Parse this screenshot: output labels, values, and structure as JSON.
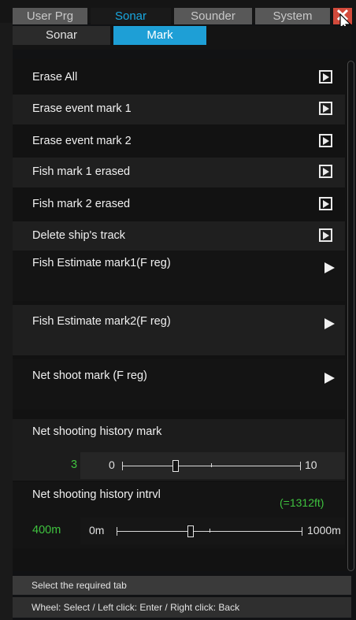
{
  "top_tabs": [
    "User Prg",
    "Sonar",
    "Sounder",
    "System"
  ],
  "sub_tabs": [
    "Sonar",
    "Mark"
  ],
  "actions": [
    "Erase All",
    "Erase event mark 1",
    "Erase event mark 2",
    "Fish mark 1 erased",
    "Fish mark 2 erased",
    "Delete ship's track"
  ],
  "submenus": [
    "Fish Estimate mark1(F reg)",
    "Fish Estimate mark2(F reg)",
    "Net shoot mark (F reg)"
  ],
  "net_history_mark": {
    "title": "Net shooting history mark",
    "value": "3",
    "min": "0",
    "max": "10",
    "level": 0.3
  },
  "net_history_intrvl": {
    "title": "Net shooting history intrvl",
    "converted": "(=1312ft)",
    "value": "400m",
    "min": "0m",
    "max": "1000m",
    "level": 0.4
  },
  "status": {
    "hint": "Select the required tab",
    "controls": "Wheel: Select / Left click: Enter / Right click: Back"
  },
  "colors": {
    "active_tab_text": "#19a8e0",
    "active_subtab": "#1e9fd6",
    "value_green": "#3fc33f",
    "close": "#d24a3b"
  },
  "icons": [
    "close-icon",
    "play-box-icon",
    "play-arrow-icon",
    "cursor-icon"
  ]
}
